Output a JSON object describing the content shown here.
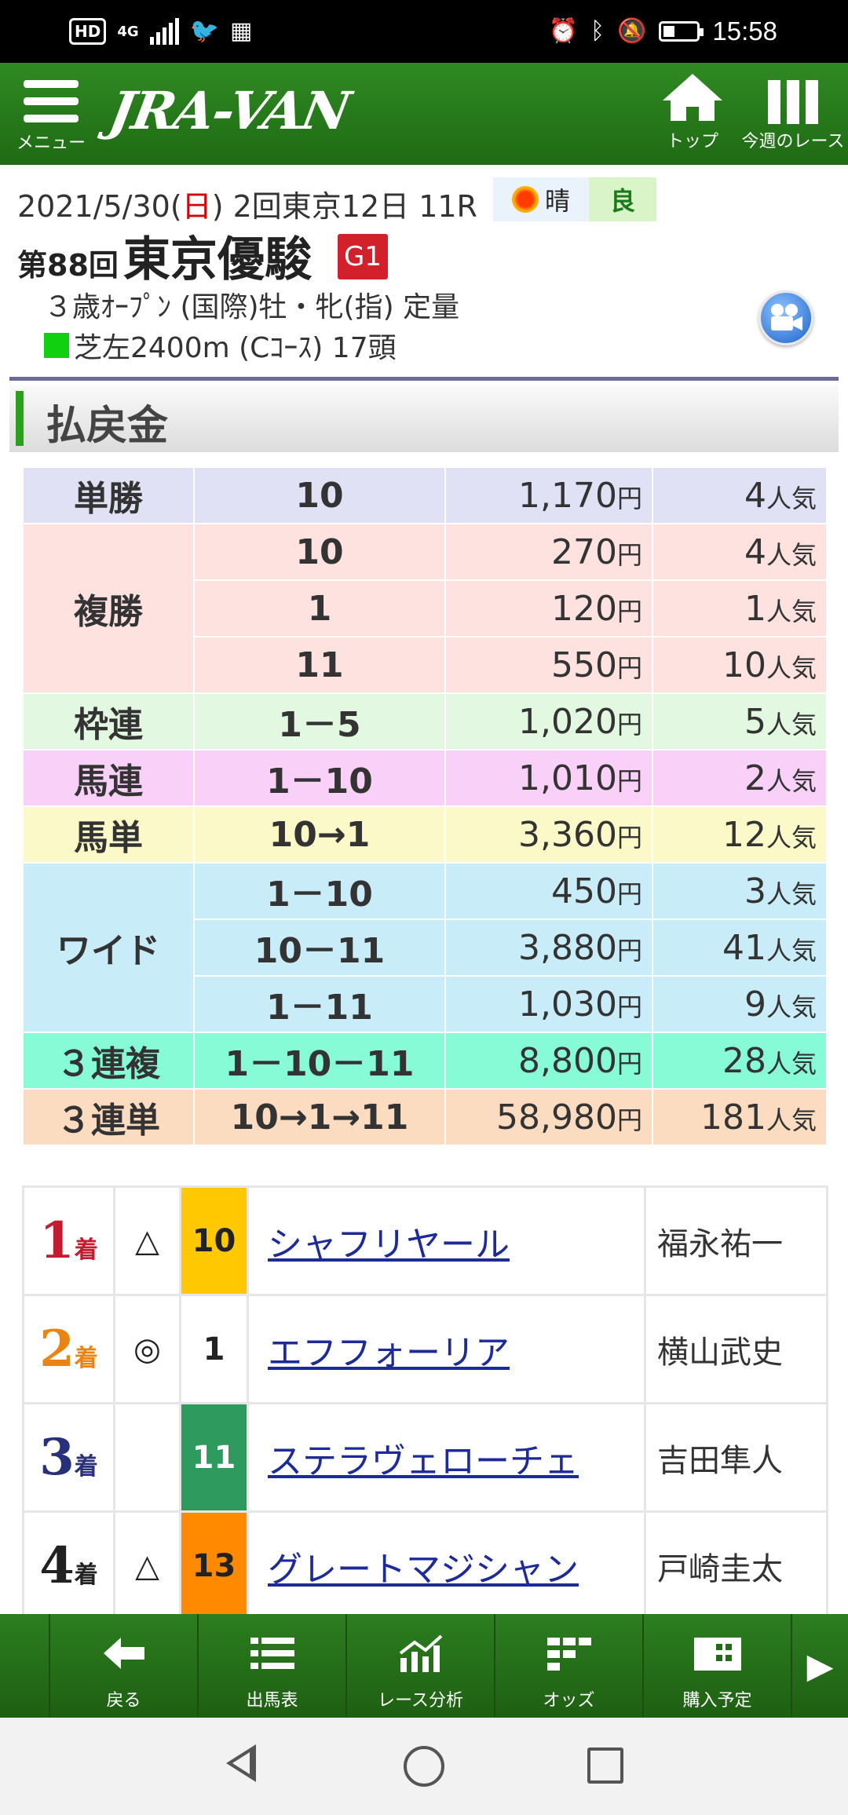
{
  "status_bar": {
    "left_icons": [
      "hd-icon",
      "4g-signal-icon",
      "twitter-icon",
      "calendar-icon"
    ],
    "network": "4G",
    "hd": "HD",
    "time": "15:58"
  },
  "app_header": {
    "menu_label": "メニュー",
    "logo_text": "JRA-VAN",
    "top_label": "トップ",
    "week_label": "今週のレース"
  },
  "race": {
    "date_prefix": "2021/5/30(",
    "day": "日",
    "date_suffix": ") 2回東京12日 11R",
    "weather": "晴",
    "going": "良",
    "number": "第88回",
    "name": "東京優駿",
    "grade": "G1",
    "conditions": "３歳ｵｰﾌﾟﾝ (国際)牡・牝(指) 定量",
    "course": "芝左2400m (Cｺｰｽ) 17頭"
  },
  "section_title": "払戻金",
  "payout_unit": "円",
  "popularity_unit": "人気",
  "payouts": [
    {
      "type": "単勝",
      "rows": [
        {
          "combo": "10",
          "amount": "1,170",
          "pop": "4"
        }
      ]
    },
    {
      "type": "複勝",
      "rows": [
        {
          "combo": "10",
          "amount": "270",
          "pop": "4"
        },
        {
          "combo": "1",
          "amount": "120",
          "pop": "1"
        },
        {
          "combo": "11",
          "amount": "550",
          "pop": "10"
        }
      ]
    },
    {
      "type": "枠連",
      "rows": [
        {
          "combo": "1－5",
          "amount": "1,020",
          "pop": "5"
        }
      ]
    },
    {
      "type": "馬連",
      "rows": [
        {
          "combo": "1－10",
          "amount": "1,010",
          "pop": "2"
        }
      ]
    },
    {
      "type": "馬単",
      "rows": [
        {
          "combo": "10→1",
          "amount": "3,360",
          "pop": "12"
        }
      ]
    },
    {
      "type": "ワイド",
      "rows": [
        {
          "combo": "1－10",
          "amount": "450",
          "pop": "3"
        },
        {
          "combo": "10－11",
          "amount": "3,880",
          "pop": "41"
        },
        {
          "combo": "1－11",
          "amount": "1,030",
          "pop": "9"
        }
      ]
    },
    {
      "type": "３連複",
      "rows": [
        {
          "combo": "1－10－11",
          "amount": "8,800",
          "pop": "28"
        }
      ]
    },
    {
      "type": "３連単",
      "rows": [
        {
          "combo": "10→1→11",
          "amount": "58,980",
          "pop": "181"
        }
      ]
    }
  ],
  "results": [
    {
      "pos": "1",
      "suffix": "着",
      "mark": "△",
      "num": "10",
      "horse": "シャフリヤール",
      "jockey": "福永祐一",
      "num_bg": "#ffc800",
      "num_color": "#222222"
    },
    {
      "pos": "2",
      "suffix": "着",
      "mark": "◎",
      "num": "1",
      "horse": "エフフォーリア",
      "jockey": "横山武史",
      "num_bg": "#ffffff",
      "num_color": "#222222"
    },
    {
      "pos": "3",
      "suffix": "着",
      "mark": "",
      "num": "11",
      "horse": "ステラヴェローチェ",
      "jockey": "吉田隼人",
      "num_bg": "#2e9a5e",
      "num_color": "#ffffff"
    },
    {
      "pos": "4",
      "suffix": "着",
      "mark": "△",
      "num": "13",
      "horse": "グレートマジシャン",
      "jockey": "戸崎圭太",
      "num_bg": "#ff8a00",
      "num_color": "#222222"
    }
  ],
  "bottom_nav": [
    {
      "label": "戻る",
      "icon": "back-arrow-icon"
    },
    {
      "label": "出馬表",
      "icon": "list-icon"
    },
    {
      "label": "レース分析",
      "icon": "analysis-chart-icon"
    },
    {
      "label": "オッズ",
      "icon": "odds-icon"
    },
    {
      "label": "購入予定",
      "icon": "purchase-plan-icon"
    }
  ]
}
